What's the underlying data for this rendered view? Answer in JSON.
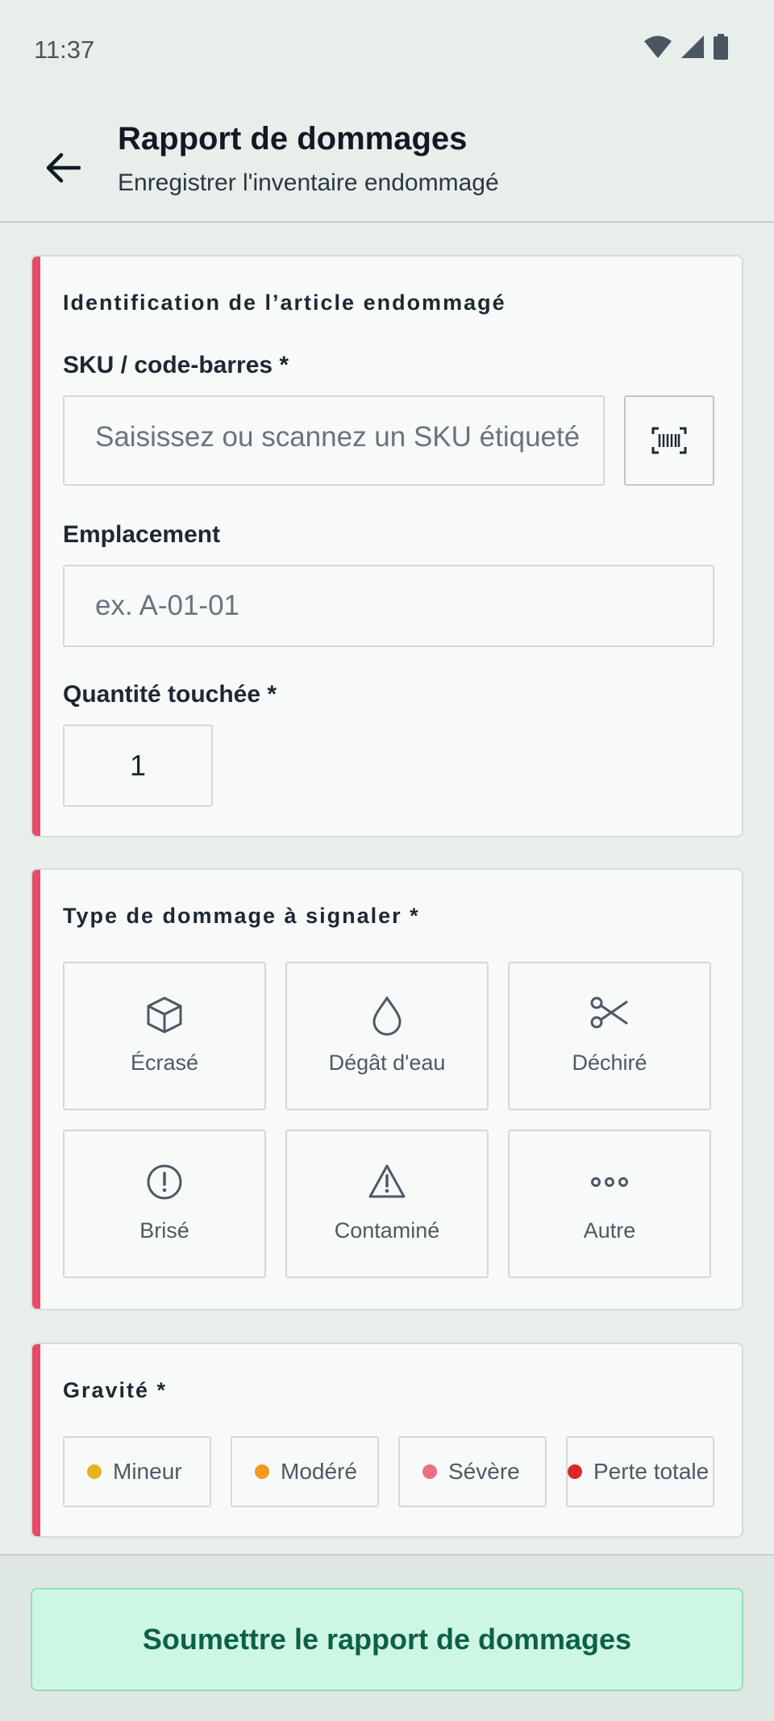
{
  "status_bar": {
    "time": "11:37"
  },
  "header": {
    "title": "Rapport de dommages",
    "subtitle": "Enregistrer l'inventaire endommagé"
  },
  "identification": {
    "section_title": "Identification de l’article endommagé",
    "sku_label": "SKU / code-barres *",
    "sku_placeholder": "Saisissez ou scannez un SKU étiqueté",
    "location_label": "Emplacement",
    "location_placeholder": "ex. A-01-01",
    "quantity_label": "Quantité touchée *",
    "quantity_value": "1"
  },
  "damage_type": {
    "section_title": "Type de dommage à signaler *",
    "options": [
      {
        "label": "Écrasé",
        "icon": "box-icon"
      },
      {
        "label": "Dégât d'eau",
        "icon": "water-drop-icon"
      },
      {
        "label": "Déchiré",
        "icon": "scissors-icon"
      },
      {
        "label": "Brisé",
        "icon": "alert-circle-icon"
      },
      {
        "label": "Contaminé",
        "icon": "warning-triangle-icon"
      },
      {
        "label": "Autre",
        "icon": "more-dots-icon"
      }
    ]
  },
  "severity": {
    "section_title": "Gravité *",
    "options": [
      {
        "label": "Mineur",
        "color": "#e3b31c"
      },
      {
        "label": "Modéré",
        "color": "#ef9a1a"
      },
      {
        "label": "Sévère",
        "color": "#ef6e86"
      },
      {
        "label": "Perte totale",
        "color": "#d92a2a"
      }
    ]
  },
  "footer": {
    "submit_label": "Soumettre le rapport de dommages"
  },
  "colors": {
    "accent_bar": "#e84a67",
    "submit_bg": "#cdf7e3",
    "submit_text": "#0d6048"
  }
}
